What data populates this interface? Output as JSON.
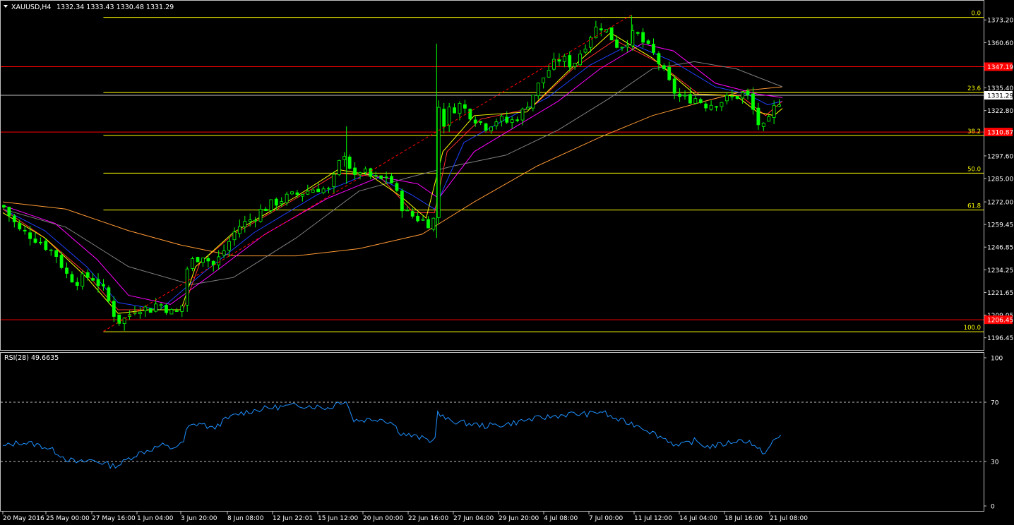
{
  "header": {
    "symbol_label": "XAUUSD,H4",
    "ohlc_label": "1332.34 1333.43 1330.48 1331.29",
    "menu_icon": "triangle-down-icon"
  },
  "colors": {
    "background": "#000000",
    "bull_candle": "#00ff00",
    "bear_candle": "#00ff00",
    "fib": "#ffff00",
    "hline": "#ff0000",
    "price_line": "#c0c0c0",
    "rsi": "#1e90ff",
    "ma_fast": "#ffff00",
    "ma_red": "#ff3030",
    "ma_blue": "#2040ff",
    "ma_magenta": "#ff00ff",
    "ma_gray": "#808080",
    "ma_orange": "#ff9933",
    "trend": "#ff0000"
  },
  "chart_data": [
    {
      "type": "candlestick",
      "title": "XAUUSD,H4",
      "ohlc_last": {
        "open": 1332.34,
        "high": 1333.43,
        "low": 1330.48,
        "close": 1331.29
      },
      "ylim": [
        1192,
        1378
      ],
      "y_ticks": [
        "1373.20",
        "1360.60",
        "1347.19",
        "1335.40",
        "1331.29",
        "1322.80",
        "1310.87",
        "1297.60",
        "1285.00",
        "1272.00",
        "1259.45",
        "1246.85",
        "1234.25",
        "1221.65",
        "1209.05",
        "1206.45",
        "1196.45"
      ],
      "x_ticks": [
        "20 May 2016",
        "25 May 00:00",
        "27 May 16:00",
        "1 Jun 04:00",
        "3 Jun 20:00",
        "8 Jun 08:00",
        "12 Jun 22:01",
        "15 Jun 12:00",
        "20 Jun 00:00",
        "22 Jun 16:00",
        "27 Jun 04:00",
        "29 Jun 20:00",
        "4 Jul 08:00",
        "7 Jul 00:00",
        "11 Jul 12:00",
        "14 Jul 04:00",
        "18 Jul 16:00",
        "21 Jul 08:00"
      ],
      "current_price": "1331.29",
      "horizontal_lines": [
        {
          "price": 1347.19,
          "label": "1347.19"
        },
        {
          "price": 1310.87,
          "label": "1310.87"
        },
        {
          "price": 1206.45,
          "label": "1206.45"
        }
      ],
      "fibonacci": [
        {
          "level": "0.0",
          "price": 1374.6
        },
        {
          "level": "23.6",
          "price": 1332.8
        },
        {
          "level": "38.2",
          "price": 1309.0
        },
        {
          "level": "50.0",
          "price": 1288.0
        },
        {
          "level": "61.8",
          "price": 1267.5
        },
        {
          "level": "100.0",
          "price": 1199.8
        }
      ],
      "close_path": [
        [
          0,
          1270
        ],
        [
          8,
          1256
        ],
        [
          14,
          1253
        ],
        [
          20,
          1248
        ],
        [
          26,
          1242
        ],
        [
          30,
          1232
        ],
        [
          35,
          1228
        ],
        [
          42,
          1231
        ],
        [
          47,
          1225
        ],
        [
          50,
          1218
        ],
        [
          53,
          1210
        ],
        [
          56,
          1205
        ],
        [
          60,
          1209
        ],
        [
          64,
          1214
        ],
        [
          70,
          1212
        ],
        [
          74,
          1216
        ],
        [
          78,
          1213
        ],
        [
          82,
          1209
        ],
        [
          86,
          1215
        ],
        [
          88,
          1235
        ],
        [
          91,
          1240
        ],
        [
          96,
          1243
        ],
        [
          100,
          1236
        ],
        [
          104,
          1242
        ],
        [
          108,
          1250
        ],
        [
          112,
          1258
        ],
        [
          118,
          1262
        ],
        [
          124,
          1268
        ],
        [
          132,
          1273
        ],
        [
          140,
          1276
        ],
        [
          150,
          1280
        ],
        [
          156,
          1278
        ],
        [
          160,
          1292
        ],
        [
          164,
          1302
        ],
        [
          167,
          1282
        ],
        [
          170,
          1290
        ],
        [
          175,
          1286
        ],
        [
          180,
          1284
        ],
        [
          184,
          1287
        ],
        [
          188,
          1276
        ],
        [
          192,
          1266
        ],
        [
          196,
          1264
        ],
        [
          200,
          1262
        ],
        [
          204,
          1260
        ],
        [
          206,
          1263
        ],
        [
          207,
          1340
        ],
        [
          209,
          1310
        ],
        [
          212,
          1322
        ],
        [
          218,
          1326
        ],
        [
          224,
          1320
        ],
        [
          230,
          1314
        ],
        [
          236,
          1318
        ],
        [
          242,
          1316
        ],
        [
          248,
          1322
        ],
        [
          254,
          1334
        ],
        [
          260,
          1345
        ],
        [
          266,
          1352
        ],
        [
          272,
          1348
        ],
        [
          278,
          1360
        ],
        [
          282,
          1368
        ],
        [
          286,
          1370
        ],
        [
          290,
          1364
        ],
        [
          294,
          1358
        ],
        [
          298,
          1362
        ],
        [
          302,
          1366
        ],
        [
          306,
          1360
        ],
        [
          312,
          1352
        ],
        [
          316,
          1342
        ],
        [
          320,
          1334
        ],
        [
          324,
          1329
        ],
        [
          330,
          1330
        ],
        [
          336,
          1326
        ],
        [
          342,
          1328
        ],
        [
          348,
          1330
        ],
        [
          353,
          1332
        ],
        [
          356,
          1330
        ],
        [
          360,
          1316
        ],
        [
          364,
          1312
        ],
        [
          368,
          1324
        ],
        [
          372,
          1331
        ]
      ],
      "ma_fast": [
        [
          0,
          1266
        ],
        [
          20,
          1252
        ],
        [
          40,
          1230
        ],
        [
          55,
          1210
        ],
        [
          70,
          1212
        ],
        [
          85,
          1212
        ],
        [
          92,
          1236
        ],
        [
          110,
          1255
        ],
        [
          140,
          1275
        ],
        [
          160,
          1290
        ],
        [
          175,
          1287
        ],
        [
          190,
          1275
        ],
        [
          202,
          1263
        ],
        [
          210,
          1300
        ],
        [
          225,
          1320
        ],
        [
          250,
          1322
        ],
        [
          270,
          1345
        ],
        [
          290,
          1366
        ],
        [
          310,
          1352
        ],
        [
          330,
          1332
        ],
        [
          350,
          1331
        ],
        [
          360,
          1322
        ],
        [
          368,
          1320
        ],
        [
          372,
          1324
        ]
      ],
      "ma_red": [
        [
          0,
          1268
        ],
        [
          20,
          1252
        ],
        [
          40,
          1232
        ],
        [
          55,
          1212
        ],
        [
          70,
          1212
        ],
        [
          86,
          1212
        ],
        [
          94,
          1238
        ],
        [
          110,
          1254
        ],
        [
          140,
          1274
        ],
        [
          160,
          1288
        ],
        [
          180,
          1286
        ],
        [
          196,
          1266
        ],
        [
          206,
          1266
        ],
        [
          212,
          1300
        ],
        [
          228,
          1318
        ],
        [
          252,
          1324
        ],
        [
          272,
          1346
        ],
        [
          292,
          1362
        ],
        [
          312,
          1350
        ],
        [
          332,
          1332
        ],
        [
          352,
          1331
        ],
        [
          364,
          1320
        ],
        [
          372,
          1328
        ]
      ],
      "ma_blue": [
        [
          0,
          1268
        ],
        [
          20,
          1256
        ],
        [
          40,
          1236
        ],
        [
          55,
          1216
        ],
        [
          75,
          1212
        ],
        [
          95,
          1232
        ],
        [
          120,
          1255
        ],
        [
          150,
          1276
        ],
        [
          175,
          1288
        ],
        [
          195,
          1276
        ],
        [
          206,
          1268
        ],
        [
          220,
          1305
        ],
        [
          240,
          1318
        ],
        [
          260,
          1330
        ],
        [
          280,
          1348
        ],
        [
          300,
          1360
        ],
        [
          320,
          1350
        ],
        [
          340,
          1336
        ],
        [
          355,
          1332
        ],
        [
          365,
          1326
        ],
        [
          372,
          1328
        ]
      ],
      "ma_magenta": [
        [
          0,
          1270
        ],
        [
          25,
          1260
        ],
        [
          45,
          1240
        ],
        [
          60,
          1220
        ],
        [
          80,
          1215
        ],
        [
          100,
          1232
        ],
        [
          125,
          1254
        ],
        [
          155,
          1274
        ],
        [
          180,
          1286
        ],
        [
          198,
          1282
        ],
        [
          208,
          1274
        ],
        [
          225,
          1300
        ],
        [
          245,
          1314
        ],
        [
          265,
          1328
        ],
        [
          285,
          1346
        ],
        [
          305,
          1360
        ],
        [
          320,
          1356
        ],
        [
          340,
          1338
        ],
        [
          360,
          1332
        ],
        [
          372,
          1330
        ]
      ],
      "ma_gray": [
        [
          0,
          1268
        ],
        [
          30,
          1258
        ],
        [
          60,
          1236
        ],
        [
          90,
          1226
        ],
        [
          110,
          1230
        ],
        [
          140,
          1252
        ],
        [
          170,
          1278
        ],
        [
          195,
          1286
        ],
        [
          215,
          1292
        ],
        [
          240,
          1298
        ],
        [
          265,
          1312
        ],
        [
          290,
          1330
        ],
        [
          310,
          1346
        ],
        [
          330,
          1350
        ],
        [
          350,
          1346
        ],
        [
          372,
          1336
        ]
      ],
      "ma_orange": [
        [
          0,
          1272
        ],
        [
          30,
          1268
        ],
        [
          60,
          1256
        ],
        [
          85,
          1248
        ],
        [
          110,
          1242
        ],
        [
          140,
          1242
        ],
        [
          170,
          1246
        ],
        [
          200,
          1254
        ],
        [
          225,
          1272
        ],
        [
          255,
          1292
        ],
        [
          285,
          1308
        ],
        [
          310,
          1320
        ],
        [
          335,
          1328
        ],
        [
          355,
          1334
        ],
        [
          372,
          1336
        ]
      ],
      "trend_line": [
        [
          48,
          1200
        ],
        [
          300,
          1376
        ]
      ]
    },
    {
      "type": "line",
      "title": "RSI(28) 49.6635",
      "ylim": [
        0,
        100
      ],
      "y_ticks": [
        "100",
        "70",
        "30",
        "0"
      ],
      "levels": [
        70,
        30
      ],
      "rsi_path": [
        [
          0,
          40
        ],
        [
          8,
          43
        ],
        [
          14,
          42
        ],
        [
          20,
          40
        ],
        [
          26,
          36
        ],
        [
          30,
          32
        ],
        [
          36,
          29
        ],
        [
          42,
          31
        ],
        [
          48,
          29
        ],
        [
          52,
          27
        ],
        [
          56,
          28
        ],
        [
          60,
          32
        ],
        [
          64,
          35
        ],
        [
          70,
          38
        ],
        [
          76,
          41
        ],
        [
          80,
          39
        ],
        [
          86,
          42
        ],
        [
          88,
          53
        ],
        [
          94,
          56
        ],
        [
          100,
          52
        ],
        [
          106,
          58
        ],
        [
          112,
          62
        ],
        [
          118,
          64
        ],
        [
          126,
          66
        ],
        [
          134,
          67
        ],
        [
          142,
          68
        ],
        [
          150,
          67
        ],
        [
          156,
          66
        ],
        [
          160,
          70
        ],
        [
          164,
          71
        ],
        [
          167,
          58
        ],
        [
          172,
          58
        ],
        [
          180,
          59
        ],
        [
          186,
          56
        ],
        [
          190,
          49
        ],
        [
          196,
          47
        ],
        [
          202,
          45
        ],
        [
          206,
          43
        ],
        [
          207,
          63
        ],
        [
          212,
          58
        ],
        [
          220,
          56
        ],
        [
          230,
          54
        ],
        [
          240,
          55
        ],
        [
          250,
          58
        ],
        [
          260,
          60
        ],
        [
          270,
          62
        ],
        [
          280,
          62
        ],
        [
          286,
          64
        ],
        [
          290,
          60
        ],
        [
          296,
          57
        ],
        [
          304,
          54
        ],
        [
          312,
          48
        ],
        [
          318,
          44
        ],
        [
          322,
          40
        ],
        [
          330,
          44
        ],
        [
          336,
          40
        ],
        [
          342,
          41
        ],
        [
          350,
          44
        ],
        [
          356,
          44
        ],
        [
          360,
          38
        ],
        [
          364,
          36
        ],
        [
          368,
          44
        ],
        [
          372,
          48
        ]
      ]
    }
  ]
}
